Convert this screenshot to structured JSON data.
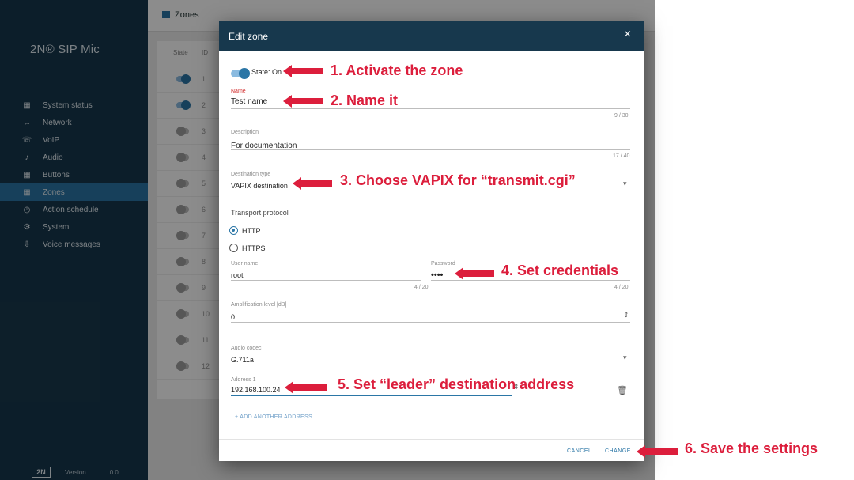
{
  "app": {
    "logo": "2N® SIP Mic",
    "nav": [
      {
        "label": "System status",
        "icon": "▦"
      },
      {
        "label": "Network",
        "icon": "↔"
      },
      {
        "label": "VoIP",
        "icon": "☏"
      },
      {
        "label": "Audio",
        "icon": "♪"
      },
      {
        "label": "Buttons",
        "icon": "▦"
      },
      {
        "label": "Zones",
        "icon": "▦",
        "active": true
      },
      {
        "label": "Action schedule",
        "icon": "◷"
      },
      {
        "label": "System",
        "icon": "⚙"
      },
      {
        "label": "Voice messages",
        "icon": "⇩"
      }
    ],
    "footer": {
      "brand": "2N",
      "text1": "Version",
      "text2": "0.0"
    },
    "page_title": "Zones",
    "table_headers": [
      "State",
      "ID"
    ]
  },
  "dialog": {
    "title": "Edit zone",
    "close_icon": "×",
    "state_label": "State: On",
    "name": {
      "label": "Name",
      "value": "Test name",
      "counter": "9 / 30"
    },
    "description": {
      "label": "Description",
      "value": "For documentation",
      "counter": "17 / 40"
    },
    "destination_type": {
      "label": "Destination type",
      "value": "VAPIX destination"
    },
    "transport": {
      "label": "Transport protocol",
      "options": [
        "HTTP",
        "HTTPS"
      ],
      "selected": "HTTP"
    },
    "username": {
      "label": "User name",
      "value": "root",
      "counter": "4 / 20"
    },
    "password": {
      "label": "Password",
      "value": "••••",
      "counter": "4 / 20"
    },
    "amplification": {
      "label": "Amplification level [dB]",
      "value": "0"
    },
    "audio_codec": {
      "label": "Audio codec",
      "value": "G.711a"
    },
    "address": {
      "label": "Address 1",
      "value": "192.168.100.24"
    },
    "add_link": "+ ADD ANOTHER ADDRESS",
    "cancel": "CANCEL",
    "change": "CHANGE"
  },
  "annotations": [
    "1. Activate the zone",
    "2. Name it",
    "3. Choose VAPIX for “transmit.cgi”",
    "4. Set credentials",
    "5. Set “leader” destination address",
    "6. Save the settings"
  ],
  "colors": {
    "annotation": "#dc1e3c",
    "accent": "#2b76a6",
    "sidebar": "#17384d"
  }
}
